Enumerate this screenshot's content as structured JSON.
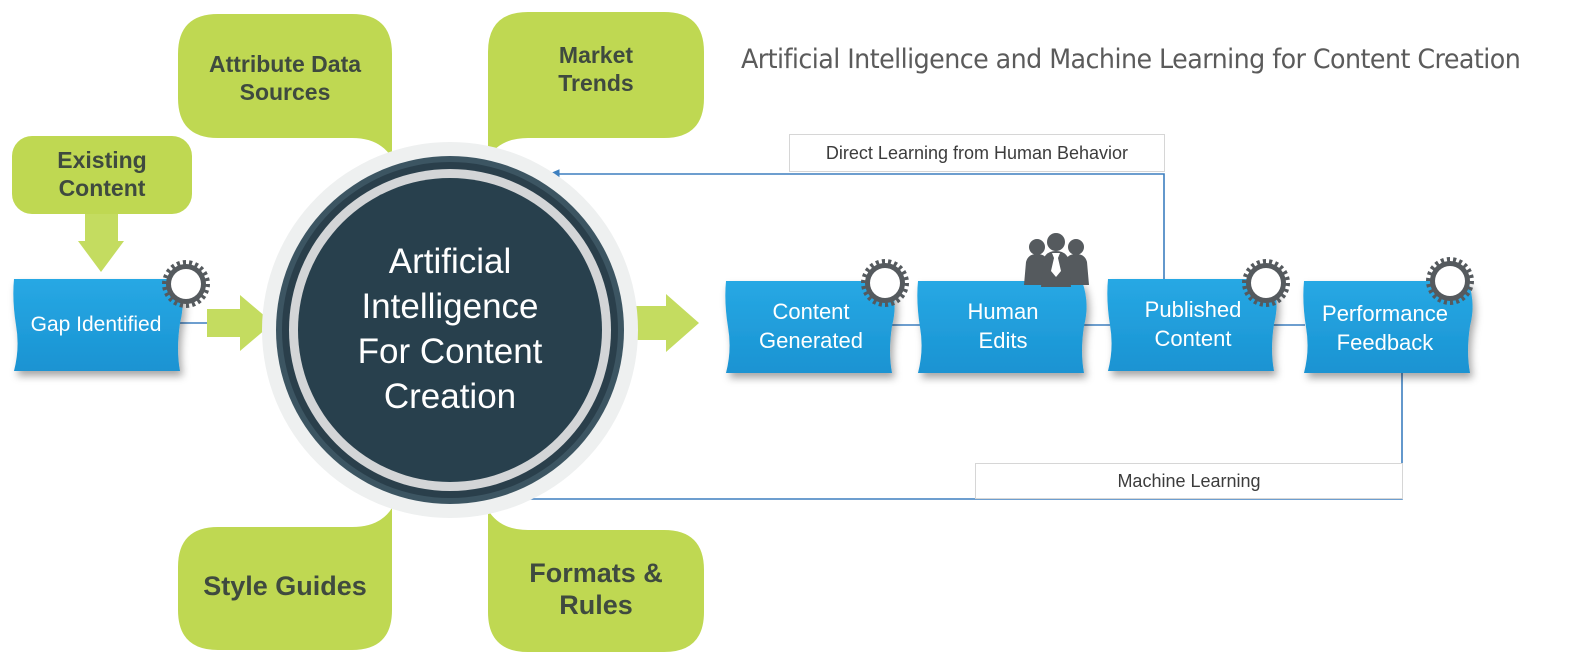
{
  "title": "Artificial Intelligence and Machine Learning for Content Creation",
  "colors": {
    "bubble_green": "#bfd852",
    "step_blue": "#1f9fdd",
    "core_dark": "#28404d",
    "gear_gray": "#555a5e",
    "connector_blue": "#3d7fbf",
    "label_text": "#3c3c3c"
  },
  "core": {
    "label": "Artificial\nIntelligence\nFor Content\nCreation"
  },
  "inputs": {
    "existing_content": "Existing\nContent",
    "attribute_data_sources": "Attribute Data\nSources",
    "market_trends": "Market\nTrends",
    "style_guides": "Style Guides",
    "formats_rules": "Formats &\nRules"
  },
  "steps": [
    {
      "label": "Gap Identified",
      "icon": "gear-icon"
    },
    {
      "label": "Content\nGenerated",
      "icon": "gear-icon"
    },
    {
      "label": "Human\nEdits",
      "icon": "people-icon"
    },
    {
      "label": "Published\nContent",
      "icon": "gear-icon"
    },
    {
      "label": "Performance\nFeedback",
      "icon": "gear-icon"
    }
  ],
  "feedback_loops": {
    "direct_learning": "Direct Learning from Human Behavior",
    "machine_learning": "Machine Learning"
  }
}
